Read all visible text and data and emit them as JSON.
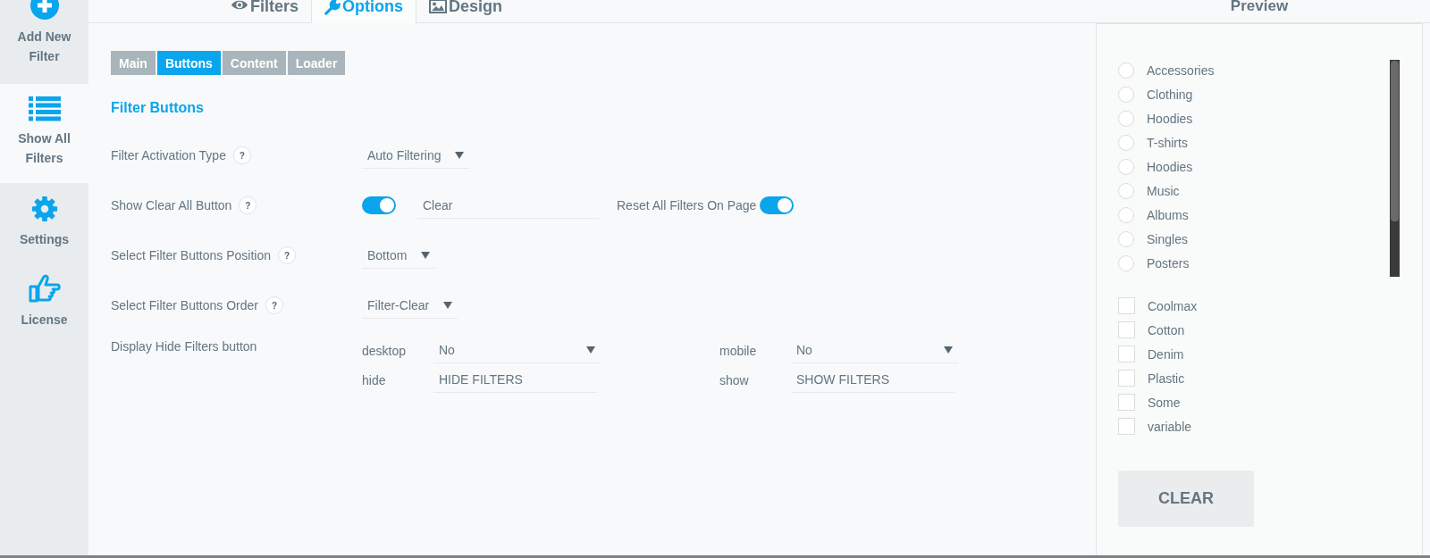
{
  "sidebar": {
    "items": [
      {
        "label": "Add New Filter",
        "kind": "plus",
        "selected": false
      },
      {
        "label": "Show All Filters",
        "kind": "list",
        "selected": true
      },
      {
        "label": "Settings",
        "kind": "gear",
        "selected": false
      },
      {
        "label": "License",
        "kind": "thumb",
        "selected": false
      }
    ]
  },
  "tabs": [
    {
      "label": "Filters",
      "kind": "eye",
      "selected": false
    },
    {
      "label": "Options",
      "kind": "wrench",
      "selected": true
    },
    {
      "label": "Design",
      "kind": "image",
      "selected": false
    }
  ],
  "subtabs": [
    {
      "label": "Main",
      "selected": false
    },
    {
      "label": "Buttons",
      "selected": true
    },
    {
      "label": "Content",
      "selected": false
    },
    {
      "label": "Loader",
      "selected": false
    }
  ],
  "section_title": "Filter Buttons",
  "settings": [
    {
      "kind": "select",
      "label": "Filter Activation Type",
      "help": "?",
      "value": "Auto Filtering"
    },
    {
      "kind": "toggle",
      "label": "Show Clear All Button",
      "help": "?",
      "on": true,
      "text_value": "Clear",
      "extra_label": "Reset All Filters On Page",
      "extra_on": true
    },
    {
      "kind": "select",
      "label": "Select Filter Buttons Position",
      "help": "?",
      "value": "Bottom"
    },
    {
      "kind": "select",
      "label": "Select Filter Buttons Order",
      "help": "?",
      "value": "Filter-Clear"
    },
    {
      "kind": "grid",
      "label": "Display Hide Filters button",
      "fields": [
        {
          "label": "desktop",
          "kind": "select",
          "value": "No"
        },
        {
          "label": "mobile",
          "kind": "select",
          "value": "No"
        },
        {
          "label": "hide",
          "kind": "text",
          "value": "HIDE FILTERS"
        },
        {
          "label": "show",
          "kind": "text",
          "value": "SHOW FILTERS"
        }
      ]
    }
  ],
  "preview": {
    "title": "Preview",
    "radios": [
      {
        "label": "Accessories",
        "selected": false
      },
      {
        "label": "Clothing",
        "selected": false
      },
      {
        "label": "Hoodies",
        "selected": false
      },
      {
        "label": "T-shirts",
        "selected": false
      },
      {
        "label": "Hoodies",
        "selected": false
      },
      {
        "label": "Music",
        "selected": false
      },
      {
        "label": "Albums",
        "selected": false
      },
      {
        "label": "Singles",
        "selected": false
      },
      {
        "label": "Posters",
        "selected": false
      }
    ],
    "checkboxes": [
      {
        "label": "Coolmax",
        "checked": false
      },
      {
        "label": "Cotton",
        "checked": false
      },
      {
        "label": "Denim",
        "checked": false
      },
      {
        "label": "Plastic",
        "checked": false
      },
      {
        "label": "Some",
        "checked": false
      },
      {
        "label": "variable",
        "checked": false
      }
    ],
    "button": "CLEAR"
  }
}
